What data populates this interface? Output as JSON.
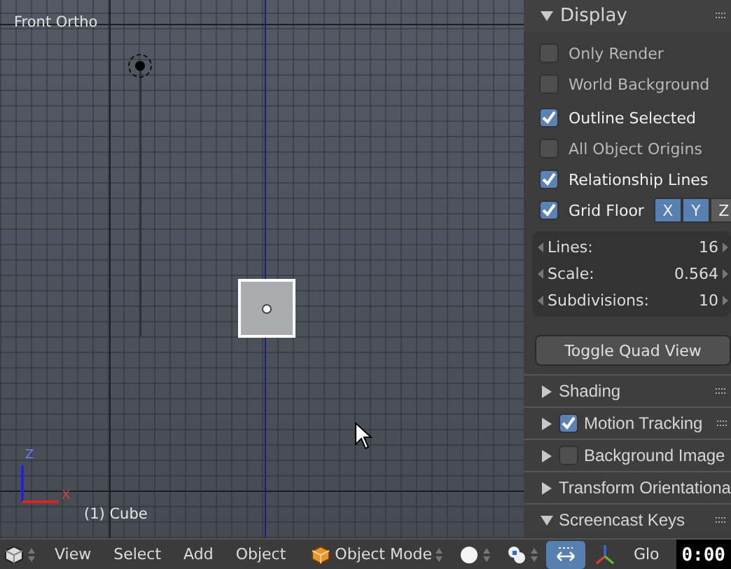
{
  "viewport": {
    "view_label": "Front Ortho",
    "object_label": "(1) Cube",
    "axis_x": "X",
    "axis_z": "Z"
  },
  "properties": {
    "display": {
      "title": "Display",
      "expanded": true
    },
    "options": [
      {
        "label": "Only Render",
        "checked": false
      },
      {
        "label": "World Background",
        "checked": false
      },
      {
        "label": "Outline Selected",
        "checked": true
      },
      {
        "label": "All Object Origins",
        "checked": false
      },
      {
        "label": "Relationship Lines",
        "checked": true
      }
    ],
    "grid_floor": {
      "label": "Grid Floor",
      "checked": true,
      "axes": [
        {
          "label": "X",
          "selected": true
        },
        {
          "label": "Y",
          "selected": true
        },
        {
          "label": "Z",
          "selected": false
        }
      ]
    },
    "fields": [
      {
        "label": "Lines:",
        "value": "16"
      },
      {
        "label": "Scale:",
        "value": "0.564"
      },
      {
        "label": "Subdivisions:",
        "value": "10"
      }
    ],
    "button": "Toggle Quad View",
    "sections": [
      {
        "title": "Shading",
        "expanded": false
      },
      {
        "title": "Motion Tracking",
        "expanded": false,
        "checked": true
      },
      {
        "title": "Background Image",
        "expanded": false,
        "checked": false
      },
      {
        "title": "Transform Orientationa",
        "expanded": false
      },
      {
        "title": "Screencast Keys",
        "expanded": true
      }
    ]
  },
  "header_bar": {
    "menus": [
      "View",
      "Select",
      "Add",
      "Object"
    ],
    "mode": "Object Mode",
    "orientation": "Glo",
    "timer": "0:00"
  }
}
